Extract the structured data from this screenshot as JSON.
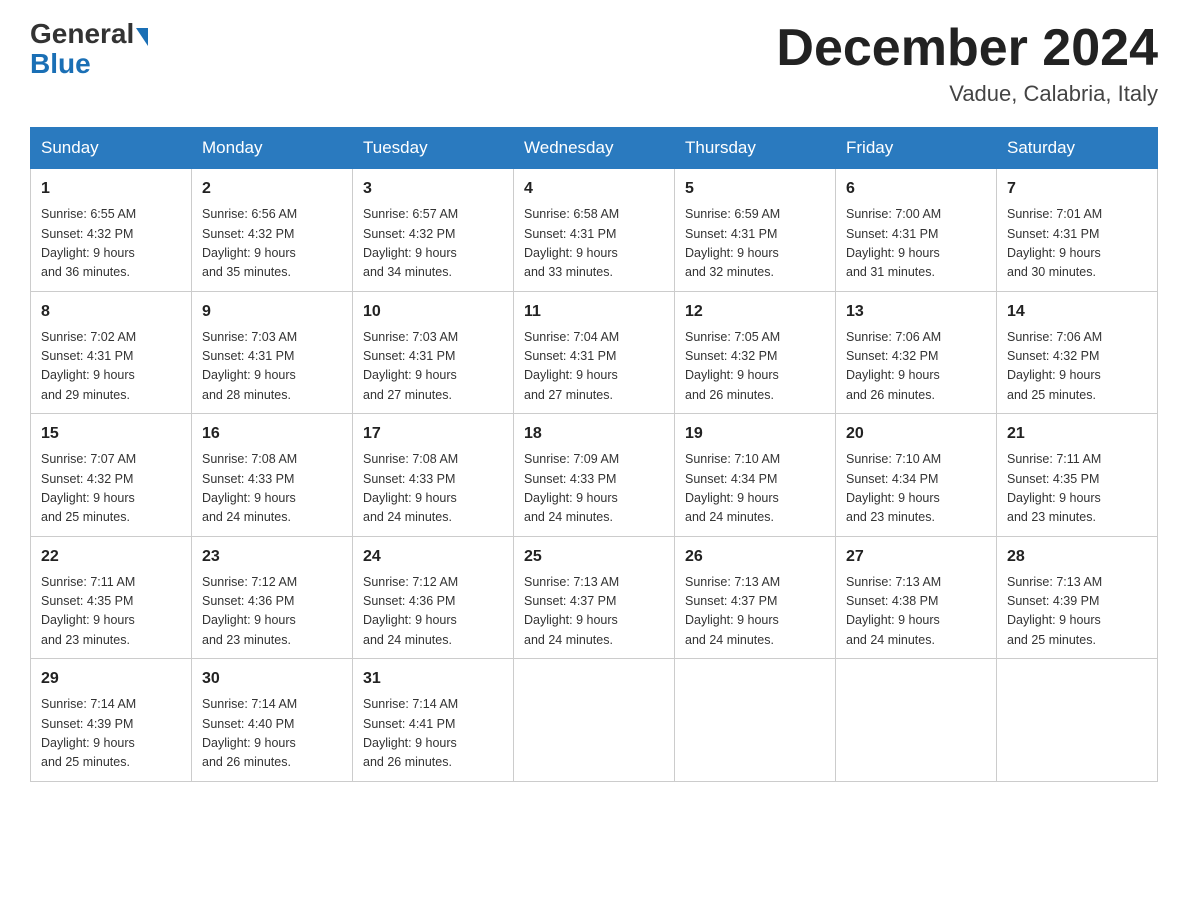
{
  "header": {
    "logo_general": "General",
    "logo_blue": "Blue",
    "month_title": "December 2024",
    "location": "Vadue, Calabria, Italy"
  },
  "days_of_week": [
    "Sunday",
    "Monday",
    "Tuesday",
    "Wednesday",
    "Thursday",
    "Friday",
    "Saturday"
  ],
  "weeks": [
    [
      {
        "day": "1",
        "sunrise": "6:55 AM",
        "sunset": "4:32 PM",
        "daylight": "9 hours and 36 minutes."
      },
      {
        "day": "2",
        "sunrise": "6:56 AM",
        "sunset": "4:32 PM",
        "daylight": "9 hours and 35 minutes."
      },
      {
        "day": "3",
        "sunrise": "6:57 AM",
        "sunset": "4:32 PM",
        "daylight": "9 hours and 34 minutes."
      },
      {
        "day": "4",
        "sunrise": "6:58 AM",
        "sunset": "4:31 PM",
        "daylight": "9 hours and 33 minutes."
      },
      {
        "day": "5",
        "sunrise": "6:59 AM",
        "sunset": "4:31 PM",
        "daylight": "9 hours and 32 minutes."
      },
      {
        "day": "6",
        "sunrise": "7:00 AM",
        "sunset": "4:31 PM",
        "daylight": "9 hours and 31 minutes."
      },
      {
        "day": "7",
        "sunrise": "7:01 AM",
        "sunset": "4:31 PM",
        "daylight": "9 hours and 30 minutes."
      }
    ],
    [
      {
        "day": "8",
        "sunrise": "7:02 AM",
        "sunset": "4:31 PM",
        "daylight": "9 hours and 29 minutes."
      },
      {
        "day": "9",
        "sunrise": "7:03 AM",
        "sunset": "4:31 PM",
        "daylight": "9 hours and 28 minutes."
      },
      {
        "day": "10",
        "sunrise": "7:03 AM",
        "sunset": "4:31 PM",
        "daylight": "9 hours and 27 minutes."
      },
      {
        "day": "11",
        "sunrise": "7:04 AM",
        "sunset": "4:31 PM",
        "daylight": "9 hours and 27 minutes."
      },
      {
        "day": "12",
        "sunrise": "7:05 AM",
        "sunset": "4:32 PM",
        "daylight": "9 hours and 26 minutes."
      },
      {
        "day": "13",
        "sunrise": "7:06 AM",
        "sunset": "4:32 PM",
        "daylight": "9 hours and 26 minutes."
      },
      {
        "day": "14",
        "sunrise": "7:06 AM",
        "sunset": "4:32 PM",
        "daylight": "9 hours and 25 minutes."
      }
    ],
    [
      {
        "day": "15",
        "sunrise": "7:07 AM",
        "sunset": "4:32 PM",
        "daylight": "9 hours and 25 minutes."
      },
      {
        "day": "16",
        "sunrise": "7:08 AM",
        "sunset": "4:33 PM",
        "daylight": "9 hours and 24 minutes."
      },
      {
        "day": "17",
        "sunrise": "7:08 AM",
        "sunset": "4:33 PM",
        "daylight": "9 hours and 24 minutes."
      },
      {
        "day": "18",
        "sunrise": "7:09 AM",
        "sunset": "4:33 PM",
        "daylight": "9 hours and 24 minutes."
      },
      {
        "day": "19",
        "sunrise": "7:10 AM",
        "sunset": "4:34 PM",
        "daylight": "9 hours and 24 minutes."
      },
      {
        "day": "20",
        "sunrise": "7:10 AM",
        "sunset": "4:34 PM",
        "daylight": "9 hours and 23 minutes."
      },
      {
        "day": "21",
        "sunrise": "7:11 AM",
        "sunset": "4:35 PM",
        "daylight": "9 hours and 23 minutes."
      }
    ],
    [
      {
        "day": "22",
        "sunrise": "7:11 AM",
        "sunset": "4:35 PM",
        "daylight": "9 hours and 23 minutes."
      },
      {
        "day": "23",
        "sunrise": "7:12 AM",
        "sunset": "4:36 PM",
        "daylight": "9 hours and 23 minutes."
      },
      {
        "day": "24",
        "sunrise": "7:12 AM",
        "sunset": "4:36 PM",
        "daylight": "9 hours and 24 minutes."
      },
      {
        "day": "25",
        "sunrise": "7:13 AM",
        "sunset": "4:37 PM",
        "daylight": "9 hours and 24 minutes."
      },
      {
        "day": "26",
        "sunrise": "7:13 AM",
        "sunset": "4:37 PM",
        "daylight": "9 hours and 24 minutes."
      },
      {
        "day": "27",
        "sunrise": "7:13 AM",
        "sunset": "4:38 PM",
        "daylight": "9 hours and 24 minutes."
      },
      {
        "day": "28",
        "sunrise": "7:13 AM",
        "sunset": "4:39 PM",
        "daylight": "9 hours and 25 minutes."
      }
    ],
    [
      {
        "day": "29",
        "sunrise": "7:14 AM",
        "sunset": "4:39 PM",
        "daylight": "9 hours and 25 minutes."
      },
      {
        "day": "30",
        "sunrise": "7:14 AM",
        "sunset": "4:40 PM",
        "daylight": "9 hours and 26 minutes."
      },
      {
        "day": "31",
        "sunrise": "7:14 AM",
        "sunset": "4:41 PM",
        "daylight": "9 hours and 26 minutes."
      },
      null,
      null,
      null,
      null
    ]
  ]
}
